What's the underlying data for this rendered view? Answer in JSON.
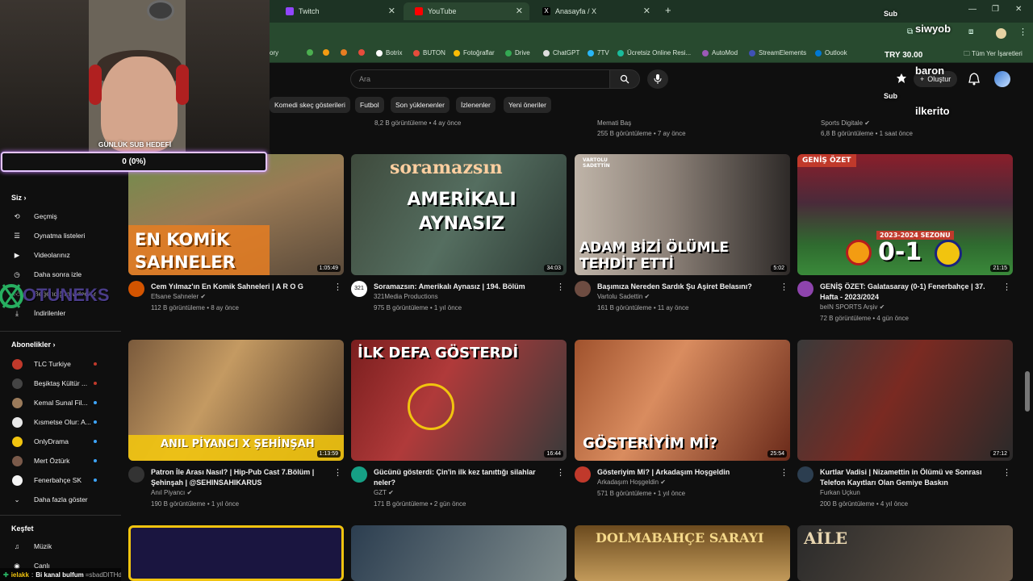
{
  "browser": {
    "tabs": [
      {
        "title": "Twitch",
        "color": "#9146ff"
      },
      {
        "title": "YouTube",
        "color": "#ff0000"
      },
      {
        "title": "Anasayfa / X",
        "color": "#000000"
      }
    ],
    "bookmarks": [
      "ory",
      "",
      "",
      "",
      "",
      "Botrix",
      "BUTON",
      "Fotoğraflar",
      "Drive",
      "ChatGPT",
      "7TV",
      "Ücretsiz Online Resi...",
      "AutoMod",
      "StreamElements",
      "Outlook"
    ],
    "price": "TRY 30.00",
    "all_bookmarks": "Tüm Yer İşaretleri"
  },
  "youtube": {
    "search_placeholder": "Ara",
    "create_label": "Oluştur",
    "chips": [
      "Komedi skeç gösterileri",
      "Futbol",
      "Son yüklenenler",
      "İzlenenler",
      "Yeni öneriler"
    ],
    "top_row_meta": [
      {
        "channel": "",
        "meta": "8,2 B görüntüleme • 4 ay önce"
      },
      {
        "channel": "Memati Baş",
        "meta": "255 B görüntüleme • 7 ay önce"
      },
      {
        "channel": "Sports Digitale ✔",
        "meta": "6,8 B görüntüleme • 1 saat önce"
      }
    ]
  },
  "sidebar": {
    "you_header": "Siz",
    "you_items": [
      "Geçmiş",
      "Oynatma listeleri",
      "Videolarınız",
      "Daha sonra izle",
      "Beğendiğim videolar",
      "İndirilenler"
    ],
    "subs_header": "Abonelikler",
    "subs": [
      {
        "name": "TLC Turkiye",
        "color": "#c0392b"
      },
      {
        "name": "Beşiktaş Kültür ...",
        "color": "#444"
      },
      {
        "name": "Kemal Sunal Fil...",
        "color": "#9b7b5b"
      },
      {
        "name": "Kısmetse Olur: A...",
        "color": "#e8e8e8"
      },
      {
        "name": "OnlyDrama",
        "color": "#f1c40f"
      },
      {
        "name": "Mert Öztürk",
        "color": "#7a5a4a"
      },
      {
        "name": "Fenerbahçe SK",
        "color": "#f5f5f5"
      }
    ],
    "more_label": "Daha fazla göster",
    "explore_header": "Keşfet",
    "explore_items": [
      "Müzik",
      "Canlı"
    ]
  },
  "stream_overlay": {
    "goal_title": "GÜNLÜK SUB HEDEFİ",
    "goal_value": "0 (0%)",
    "alerts": [
      {
        "label": "Sub",
        "name": "siwyob"
      },
      {
        "label": "",
        "name": "baron"
      },
      {
        "label": "Sub",
        "name": "ilkerito"
      }
    ],
    "brand": "OTUNEKS",
    "chat_user": "ielakk",
    "chat_text": "Bi kanal bulfum",
    "chat_tail": "=sbadDITHdvl"
  },
  "videos": [
    {
      "title": "Cem Yılmaz'ın En Komik Sahneleri | A R O G",
      "channel": "Efsane Sahneler ✔",
      "meta": "112 B görüntüleme • 8 ay önce",
      "duration": "1:05:49",
      "thumb_text": "EN KOMİK SAHNELER",
      "avatar": "#d35400"
    },
    {
      "title": "Soramazsın: Amerikalı Aynasız | 194. Bölüm",
      "channel": "321Media Productions",
      "meta": "975 B görüntüleme • 1 yıl önce",
      "duration": "34:03",
      "thumb_text": "AMERİKALI AYNASIZ",
      "thumb_brand": "soramazsın",
      "avatar": "#ffffff"
    },
    {
      "title": "Başımıza Nereden Sardık Şu Aşiret Belasını?",
      "channel": "Vartolu Sadettin ✔",
      "meta": "161 B görüntüleme • 11 ay önce",
      "duration": "5:02",
      "thumb_text": "ADAM BİZİ ÖLÜMLE TEHDİT ETTİ",
      "thumb_brand": "VARTOLU SADETTİN",
      "avatar": "#6d4c41"
    },
    {
      "title": "GENİŞ ÖZET: Galatasaray (0-1) Fenerbahçe | 37. Hafta - 2023/2024",
      "channel": "beIN SPORTS Arşiv ✔",
      "meta": "72 B görüntüleme • 4 gün önce",
      "duration": "21:15",
      "thumb_text": "0-1",
      "thumb_badge": "GENİŞ ÖZET",
      "thumb_season": "2023-2024 SEZONU",
      "avatar": "#8e44ad"
    },
    {
      "title": "Patron İle Arası Nasıl? | Hip-Pub Cast 7.Bölüm | Şehinşah | @SEHINSAHIKARUS",
      "channel": "Anıl Piyancı ✔",
      "meta": "190 B görüntüleme • 1 yıl önce",
      "duration": "1:13:59",
      "thumb_text": "ANIL PİYANCI X ŞEHİNŞAH",
      "avatar": "#333333"
    },
    {
      "title": "Gücünü gösterdi: Çin'in ilk kez tanıttığı silahlar neler?",
      "channel": "GZT ✔",
      "meta": "171 B görüntüleme • 2 gün önce",
      "duration": "16:44",
      "thumb_text": "İLK DEFA GÖSTERDİ",
      "avatar": "#16a085"
    },
    {
      "title": "Gösteriyim Mi? | Arkadaşım Hoşgeldin",
      "channel": "Arkadaşım Hoşgeldin ✔",
      "meta": "571 B görüntüleme • 1 yıl önce",
      "duration": "25:54",
      "thumb_text": "GÖSTERİYİM Mİ?",
      "avatar": "#c0392b"
    },
    {
      "title": "Kurtlar Vadisi | Nizamettin in Ölümü ve Sonrası Telefon Kayıtları Olan Gemiye Baskın",
      "channel": "Furkan Uçkun",
      "meta": "200 B görüntüleme • 4 yıl önce",
      "duration": "27:12",
      "thumb_text": "",
      "avatar": "#2c3e50"
    }
  ],
  "bottom_row": [
    "",
    "",
    "DOLMABAHÇE SARAYI",
    "AİLE"
  ]
}
